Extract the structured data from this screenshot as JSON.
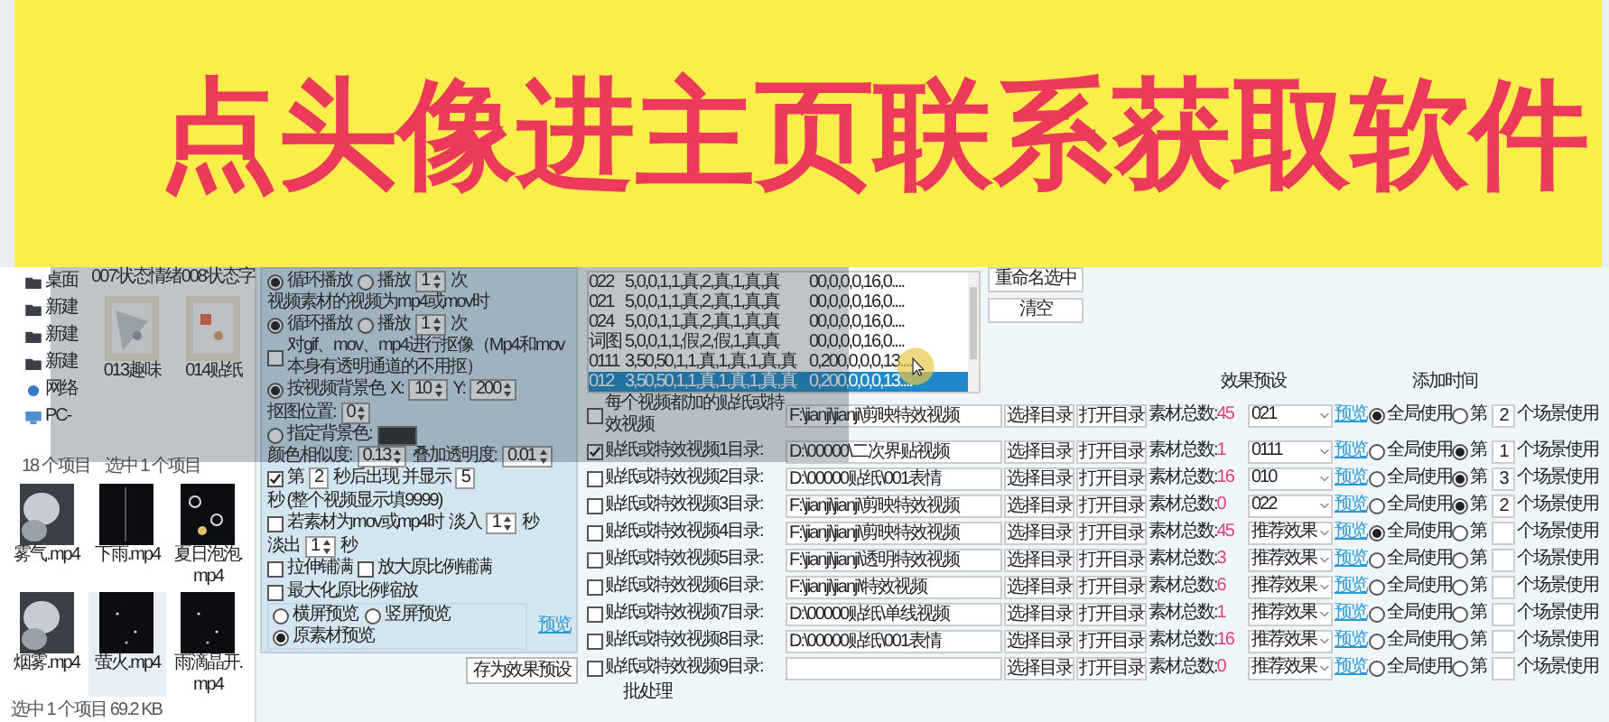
{
  "banner": {
    "text": "点头像进主页联系获取软件"
  },
  "explorer": {
    "nav": [
      {
        "label": "桌面",
        "kind": "folder"
      },
      {
        "label": "新建",
        "kind": "folder"
      },
      {
        "label": "新建",
        "kind": "folder"
      },
      {
        "label": "新建",
        "kind": "folder"
      },
      {
        "label": "网络",
        "kind": "network"
      },
      {
        "label": "PC-",
        "kind": "pc"
      }
    ],
    "top_labels": [
      "007状态情绪",
      "008状态字"
    ],
    "folders": [
      {
        "name": "013趣味"
      },
      {
        "name": "014贴纸"
      }
    ],
    "count": "18 个项目",
    "selection": "选中 1 个项目",
    "videos": [
      {
        "name": "雾气.mp4",
        "selected": false
      },
      {
        "name": "下雨.mp4",
        "selected": false
      },
      {
        "name": "夏日泡泡.mp4",
        "selected": false
      },
      {
        "name": "烟雾.mp4",
        "selected": false
      },
      {
        "name": "萤火.mp4",
        "selected": true
      },
      {
        "name": "雨滴晶开.mp4",
        "selected": false
      }
    ],
    "status": "选中 1 个项目  69.2 KB"
  },
  "settings": {
    "lines": [
      [
        {
          "kind": "radio",
          "label": "循环播放",
          "selected": true
        },
        {
          "kind": "radio",
          "label": "播放",
          "selected": false
        },
        {
          "kind": "spin",
          "value": "1"
        },
        {
          "kind": "text",
          "text": "次"
        }
      ],
      [
        {
          "kind": "text",
          "text": "视频素材的视频为mp4或mov时"
        }
      ],
      [
        {
          "kind": "radio",
          "label": "循环播放",
          "selected": true
        },
        {
          "kind": "radio",
          "label": "播放",
          "selected": false
        },
        {
          "kind": "spin",
          "value": "1"
        },
        {
          "kind": "text",
          "text": "次"
        }
      ],
      [
        {
          "kind": "checkbox",
          "label": "对gif、mov、mp4进行抠像（Mp4和mov本身有透明通道的不用抠）",
          "checked": false
        }
      ],
      [
        {
          "kind": "radio",
          "label": "按视频背景色",
          "selected": true
        },
        {
          "kind": "text",
          "text": "X:"
        },
        {
          "kind": "spin",
          "value": "10"
        },
        {
          "kind": "text",
          "text": "Y:"
        },
        {
          "kind": "spin",
          "value": "200"
        },
        {
          "kind": "text",
          "text": "抠图位置:"
        },
        {
          "kind": "spin",
          "value": "0"
        }
      ],
      [
        {
          "kind": "radio",
          "label": "指定背景色:",
          "selected": false
        },
        {
          "kind": "swatch",
          "color": "#2b2b2b"
        }
      ],
      [
        {
          "kind": "text",
          "text": "颜色相似度:"
        },
        {
          "kind": "spin",
          "value": "0.13"
        },
        {
          "kind": "text",
          "text": "叠加透明度:"
        },
        {
          "kind": "spin",
          "value": "0.01"
        }
      ],
      [
        {
          "kind": "checkbox",
          "label": "第",
          "checked": true
        },
        {
          "kind": "input",
          "value": "2"
        },
        {
          "kind": "text",
          "text": "秒后出现 并显示"
        },
        {
          "kind": "input",
          "value": "5"
        },
        {
          "kind": "text",
          "text": "秒 (整个视频显示填9999)"
        }
      ],
      [
        {
          "kind": "checkbox",
          "label": "若素材为mov或mp4时",
          "checked": false
        },
        {
          "kind": "text",
          "text": "淡入"
        },
        {
          "kind": "spin",
          "value": "1"
        },
        {
          "kind": "text",
          "text": "秒"
        },
        {
          "kind": "text",
          "text": "淡出"
        },
        {
          "kind": "spin",
          "value": "1"
        },
        {
          "kind": "text",
          "text": "秒"
        }
      ],
      [
        {
          "kind": "checkbox",
          "label": "拉伸铺满",
          "checked": false
        },
        {
          "kind": "checkbox",
          "label": "放大原比例铺满",
          "checked": false
        },
        {
          "kind": "checkbox",
          "label": "最大化原比例缩放",
          "checked": false
        }
      ]
    ],
    "preview_modes": [
      {
        "label": "横屏预览",
        "selected": false
      },
      {
        "label": "竖屏预览",
        "selected": false
      },
      {
        "label": "原素材预览",
        "selected": true
      }
    ],
    "preview_link": "预览",
    "save_button": "存为效果预设"
  },
  "presets": {
    "rows": [
      {
        "name": "022",
        "params": "5,0,0,1,1,真,2,真,1,真,真",
        "values": "00,0,0,0,16,0....",
        "selected": false
      },
      {
        "name": "021",
        "params": "5,0,0,1,1,真,2,真,1,真,真",
        "values": "00,0,0,0,16,0....",
        "selected": false
      },
      {
        "name": "024",
        "params": "5,0,0,1,1,真,2,真,1,真,真",
        "values": "00,0,0,0,16,0....",
        "selected": false
      },
      {
        "name": "词图",
        "params": "5,0,0,1,1,假,2,假,1,真,真",
        "values": "00,0,0,0,16,0....",
        "selected": false
      },
      {
        "name": "0111",
        "params": "3,50,50,1,1,真,1,真,1,真,真",
        "values": "0,200,0,0,0,13....",
        "selected": false
      },
      {
        "name": "012",
        "params": "3,50,50,1,1,真,1,真,1,真,真",
        "values": "0,200,0,0,0,13....",
        "selected": true
      }
    ],
    "buttons": [
      "重命名选中",
      "清空"
    ]
  },
  "headers": {
    "preset": "效果预设",
    "time": "添加时间"
  },
  "rows": [
    {
      "checked": false,
      "label": "每个视频都加的贴纸或特效视频",
      "path": "F:\\jianji\\jianji\\剪映特效视频",
      "choose": "选择目录",
      "open": "打开目录",
      "count_label": "素材总数:",
      "count": "45",
      "preset": "021",
      "preview": "预览",
      "global": true,
      "global_label": "全局使用",
      "nth": false,
      "nth_label": "第",
      "n": "2",
      "suffix": "个场景使用"
    },
    {
      "checked": true,
      "label": "贴纸或特效视频1目录:",
      "path": "D:\\00000\\二次界贴视频",
      "choose": "选择目录",
      "open": "打开目录",
      "count_label": "素材总数:",
      "count": "1",
      "preset": "0111",
      "preview": "预览",
      "global": false,
      "global_label": "全局使用",
      "nth": true,
      "nth_label": "第",
      "n": "1",
      "suffix": "个场景使用"
    },
    {
      "checked": false,
      "label": "贴纸或特效视频2目录:",
      "path": "D:\\00000贴纸\\001表情",
      "choose": "选择目录",
      "open": "打开目录",
      "count_label": "素材总数:",
      "count": "16",
      "preset": "010",
      "preview": "预览",
      "global": false,
      "global_label": "全局使用",
      "nth": true,
      "nth_label": "第",
      "n": "3",
      "suffix": "个场景使用"
    },
    {
      "checked": false,
      "label": "贴纸或特效视频3目录:",
      "path": "F:\\jianji\\jianji\\剪映特效视频",
      "choose": "选择目录",
      "open": "打开目录",
      "count_label": "素材总数:",
      "count": "0",
      "preset": "022",
      "preview": "预览",
      "global": false,
      "global_label": "全局使用",
      "nth": true,
      "nth_label": "第",
      "n": "2",
      "suffix": "个场景使用"
    },
    {
      "checked": false,
      "label": "贴纸或特效视频4目录:",
      "path": "F:\\jianji\\jianji\\剪映特效视频",
      "choose": "选择目录",
      "open": "打开目录",
      "count_label": "素材总数:",
      "count": "45",
      "preset": "推荐效果",
      "preview": "预览",
      "global": true,
      "global_label": "全局使用",
      "nth": false,
      "nth_label": "第",
      "suffix": "个场景使用"
    },
    {
      "checked": false,
      "label": "贴纸或特效视频5目录:",
      "path": "F:\\jianji\\jianji\\透明特效视频",
      "choose": "选择目录",
      "open": "打开目录",
      "count_label": "素材总数:",
      "count": "3",
      "preset": "推荐效果",
      "preview": "预览",
      "global": false,
      "global_label": "全局使用",
      "nth": false,
      "nth_label": "第",
      "suffix": "个场景使用"
    },
    {
      "checked": false,
      "label": "贴纸或特效视频6目录:",
      "path": "F:\\jianji\\jianji\\特效视频",
      "choose": "选择目录",
      "open": "打开目录",
      "count_label": "素材总数:",
      "count": "6",
      "preset": "推荐效果",
      "preview": "预览",
      "global": false,
      "global_label": "全局使用",
      "nth": false,
      "nth_label": "第",
      "suffix": "个场景使用"
    },
    {
      "checked": false,
      "label": "贴纸或特效视频7目录:",
      "path": "D:\\00000贴纸\\单线视频",
      "choose": "选择目录",
      "open": "打开目录",
      "count_label": "素材总数:",
      "count": "1",
      "preset": "推荐效果",
      "preview": "预览",
      "global": false,
      "global_label": "全局使用",
      "nth": false,
      "nth_label": "第",
      "suffix": "个场景使用"
    },
    {
      "checked": false,
      "label": "贴纸或特效视频8目录:",
      "path": "D:\\00000贴纸\\001表情",
      "choose": "选择目录",
      "open": "打开目录",
      "count_label": "素材总数:",
      "count": "16",
      "preset": "推荐效果",
      "preview": "预览",
      "global": false,
      "global_label": "全局使用",
      "nth": false,
      "nth_label": "第",
      "suffix": "个场景使用"
    },
    {
      "checked": false,
      "label": "贴纸或特效视频9目录:",
      "choose": "选择目录",
      "open": "打开目录",
      "count_label": "素材总数:",
      "count": "0",
      "preset": "推荐效果",
      "preview": "预览",
      "global": false,
      "global_label": "全局使用",
      "nth": false,
      "nth_label": "第",
      "suffix": "个场景使用"
    }
  ],
  "footer": "批处理"
}
